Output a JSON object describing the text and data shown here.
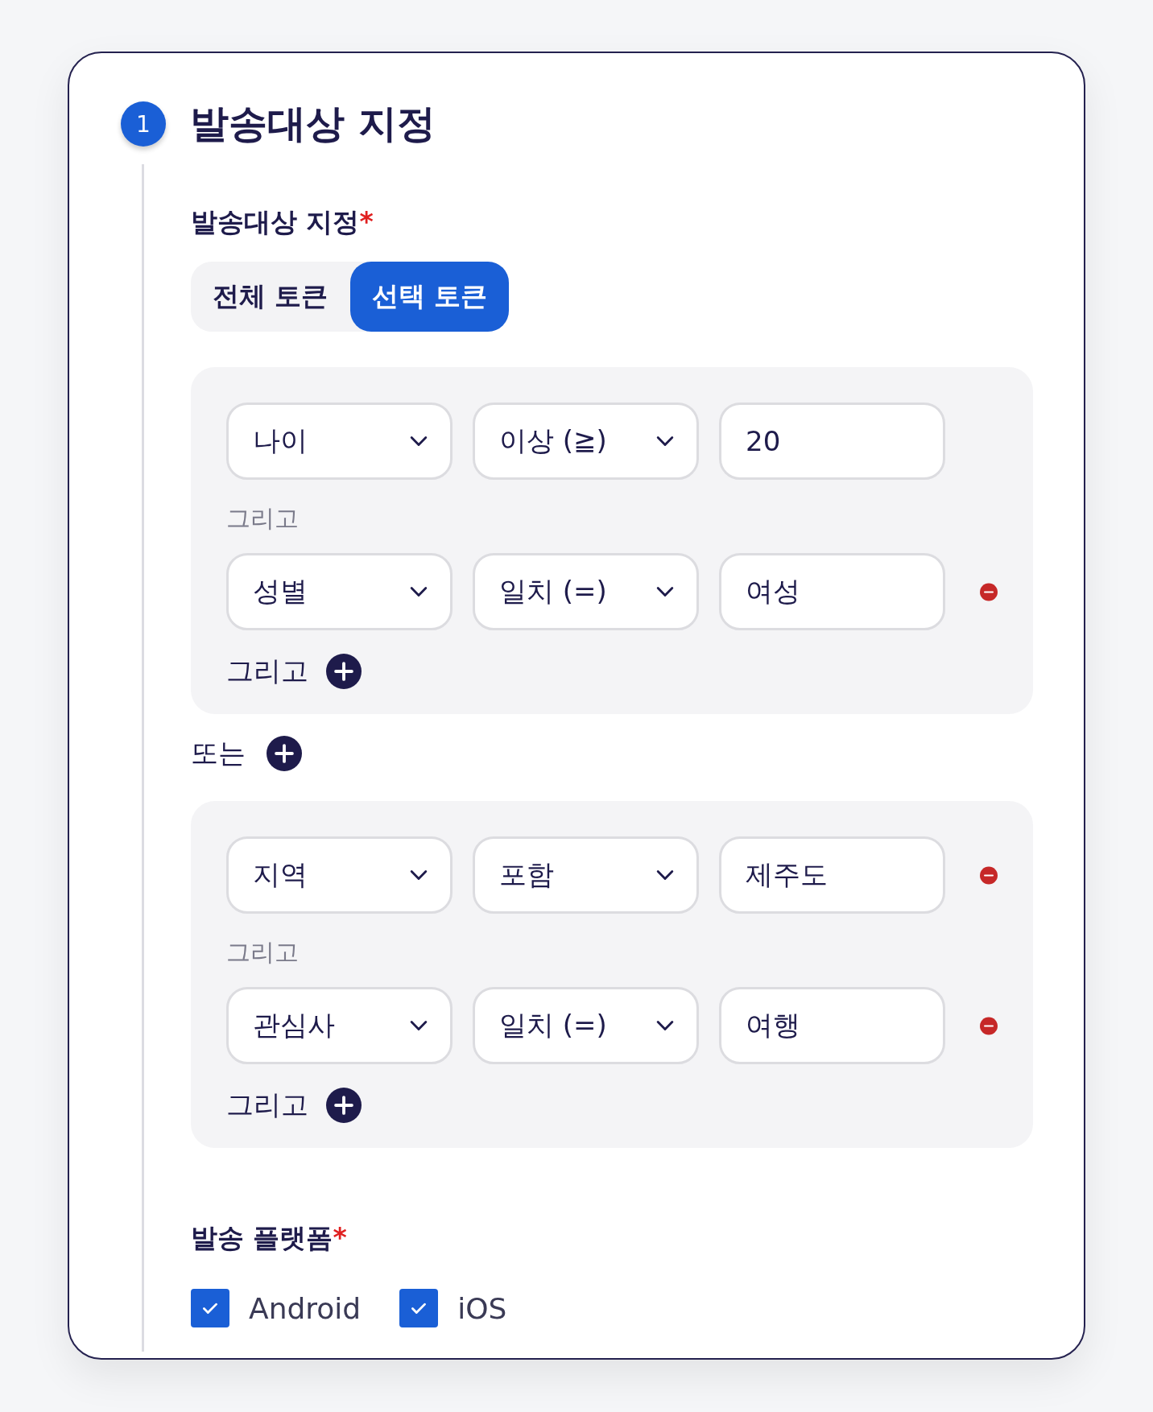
{
  "step": {
    "number": "1",
    "title": "발송대상 지정"
  },
  "target": {
    "label": "발송대상 지정",
    "required_mark": "*",
    "options": [
      {
        "label": "전체 토큰",
        "selected": false
      },
      {
        "label": "선택 토큰",
        "selected": true
      }
    ]
  },
  "groups": [
    {
      "conditions": [
        {
          "field": "나이",
          "operator": "이상 (≧)",
          "value": "20",
          "removable": false
        },
        {
          "connector": "그리고",
          "field": "성별",
          "operator": "일치 (=)",
          "value": "여성",
          "removable": true
        }
      ],
      "add_label": "그리고"
    },
    {
      "conditions": [
        {
          "field": "지역",
          "operator": "포함",
          "value": "제주도",
          "removable": true
        },
        {
          "connector": "그리고",
          "field": "관심사",
          "operator": "일치 (=)",
          "value": "여행",
          "removable": true
        }
      ],
      "add_label": "그리고"
    }
  ],
  "or_label": "또는",
  "platform": {
    "label": "발송 플랫폼",
    "required_mark": "*",
    "options": [
      {
        "label": "Android",
        "checked": true
      },
      {
        "label": "iOS",
        "checked": true
      }
    ]
  }
}
